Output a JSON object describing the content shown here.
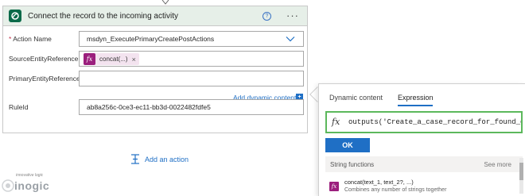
{
  "card": {
    "title": "Connect the record to the incoming activity",
    "help_glyph": "?",
    "more_glyph": "···",
    "fields": {
      "action_name": {
        "required_mark": "*",
        "label": "Action Name",
        "value": "msdyn_ExecutePrimaryCreatePostActions"
      },
      "source_entity_reference": {
        "label": "SourceEntityReference",
        "token_text": "concat(...)",
        "token_remove": "×"
      },
      "primary_entity_reference": {
        "label": "PrimaryEntityReference",
        "value": ""
      },
      "rule_id": {
        "label": "RuleId",
        "value": "ab8a256c-0ce3-ec11-bb3d-0022482fdfe5"
      }
    },
    "add_dynamic_content": "Add dynamic content"
  },
  "add_action": {
    "label": "Add an action"
  },
  "watermark": {
    "tagline": "innovative logic",
    "name": "inogic"
  },
  "popup": {
    "tabs": {
      "dynamic": "Dynamic content",
      "expression": "Expression"
    },
    "fx_glyph": "fx",
    "expression_text": "outputs('Create_a_case_record_for_found_co",
    "ok_label": "OK",
    "section_title": "String functions",
    "see_more": "See more",
    "functions": [
      {
        "signature": "concat(text_1, text_2?, ...)",
        "description": "Combines any number of strings together"
      }
    ]
  },
  "colors": {
    "accent": "#1f6fc5",
    "header_bg": "#e6efe8",
    "expression_border": "#5cb85c",
    "fx_badge": "#9b1f7d",
    "dataverse": "#0b6a49"
  }
}
